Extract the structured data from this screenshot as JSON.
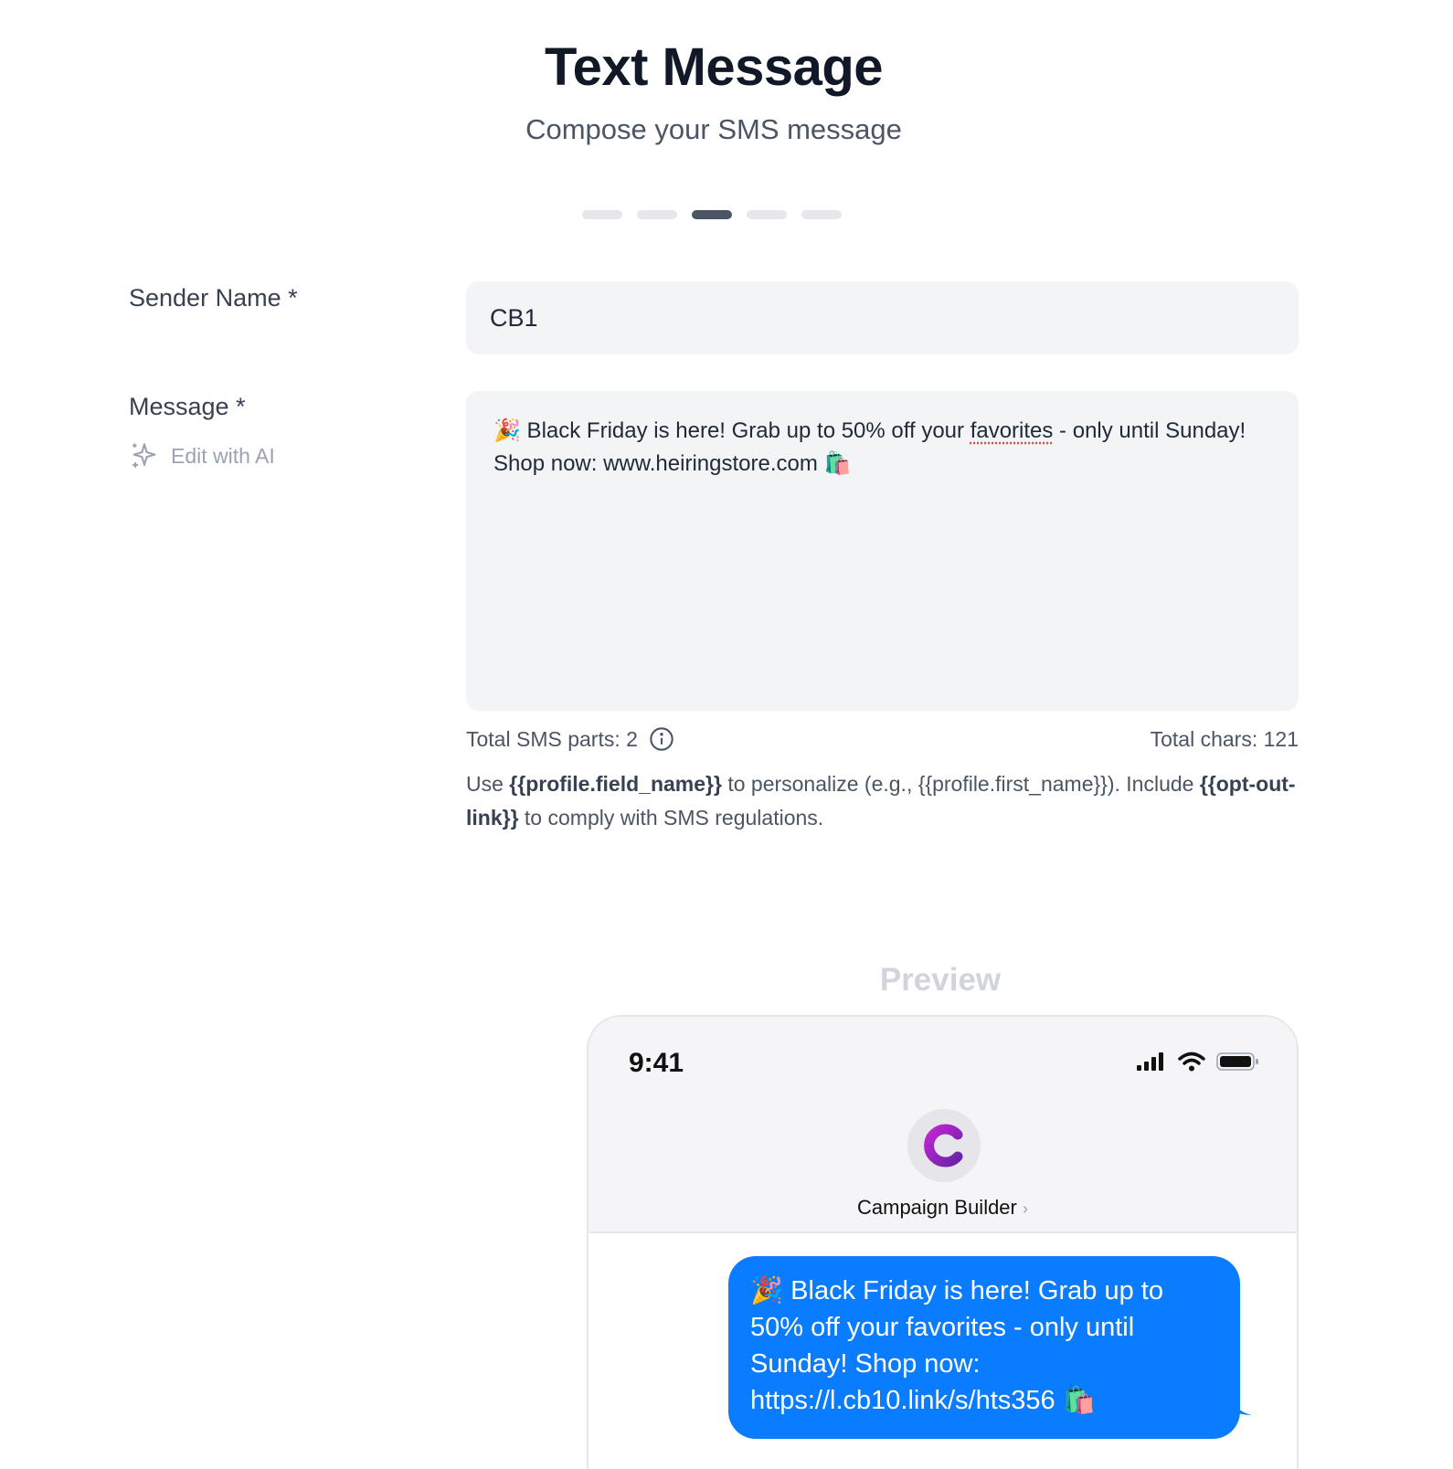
{
  "header": {
    "title": "Text Message",
    "subtitle": "Compose your SMS message"
  },
  "stepper": {
    "total_steps": 5,
    "current_step": 3
  },
  "form": {
    "sender_label": "Sender Name *",
    "sender_value": "CB1",
    "message_label": "Message *",
    "edit_ai_label": "Edit with AI",
    "message": {
      "emoji_start": "🎉",
      "part1": " Black Friday is here! Grab up to 50% off your ",
      "misspelled_word": "favorites",
      "part2": " -  only until Sunday! Shop now: www.heiringstore.com ",
      "emoji_end": "🛍️"
    },
    "sms_parts": "Total SMS parts: 2",
    "total_chars": "Total chars: 121",
    "help": {
      "t1": "Use ",
      "b1": "{{profile.field_name}}",
      "t2": " to personalize (e.g., {{profile.first_name}}). Include ",
      "b2": "{{opt-out-link}}",
      "t3": " to comply with SMS regulations."
    }
  },
  "preview": {
    "title": "Preview",
    "time": "9:41",
    "contact_name": "Campaign Builder",
    "contact_chevron": "›",
    "avatar_letter": "C",
    "bubble": {
      "emoji_start": "🎉",
      "text": " Black Friday is here! Grab up to 50% off your favorites -  only until Sunday! Shop now: https://l.cb10.link/s/hts356 ",
      "emoji_end": "🛍️"
    },
    "bubble_color": "#0a7cff"
  },
  "icons": [
    "sparkles-icon",
    "info-icon",
    "signal-icon",
    "wifi-icon",
    "battery-icon"
  ]
}
